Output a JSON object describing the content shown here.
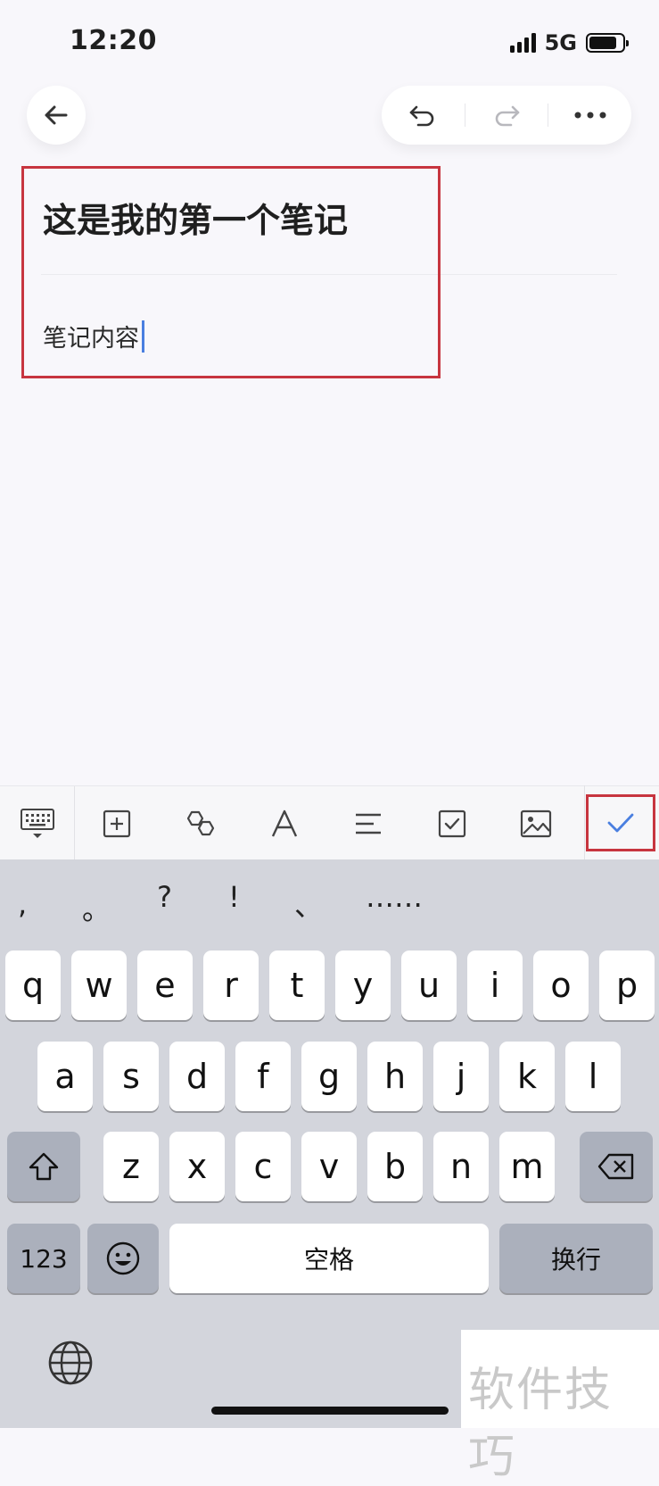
{
  "status": {
    "time": "12:20",
    "network": "5G"
  },
  "note": {
    "title": "这是我的第一个笔记",
    "body": "笔记内容"
  },
  "punctuation": [
    ",",
    "。",
    "?",
    "!",
    "、",
    "……"
  ],
  "keys": {
    "row1": [
      "q",
      "w",
      "e",
      "r",
      "t",
      "y",
      "u",
      "i",
      "o",
      "p"
    ],
    "row2": [
      "a",
      "s",
      "d",
      "f",
      "g",
      "h",
      "j",
      "k",
      "l"
    ],
    "row3": [
      "z",
      "x",
      "c",
      "v",
      "b",
      "n",
      "m"
    ],
    "numbers": "123",
    "space": "空格",
    "return": "换行"
  },
  "watermark": "软件技巧",
  "icons": {
    "back": "arrow-left-icon",
    "undo": "undo-icon",
    "redo": "redo-icon",
    "more": "more-icon",
    "keyboard": "keyboard-hide-icon",
    "add": "add-box-icon",
    "link": "hexagon-link-icon",
    "font": "font-icon",
    "align": "align-icon",
    "checkbox": "checkbox-icon",
    "image": "image-icon",
    "confirm": "check-icon",
    "shift": "shift-icon",
    "delete": "backspace-icon",
    "emoji": "emoji-icon",
    "globe": "globe-icon"
  },
  "colors": {
    "accent": "#4a7fe0",
    "highlight": "#c7353f"
  }
}
